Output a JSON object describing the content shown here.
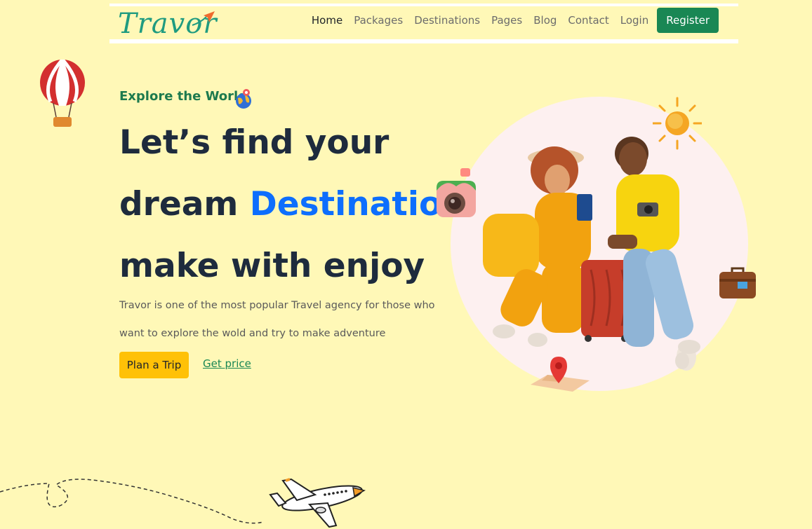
{
  "brand": {
    "name": "Travor"
  },
  "nav": {
    "links": [
      "Home",
      "Packages",
      "Destinations",
      "Pages",
      "Blog",
      "Contact",
      "Login"
    ],
    "register_label": "Register"
  },
  "hero": {
    "eyebrow": "Explore the World",
    "headline_line1": "Let’s find your",
    "headline_line2_prefix": "dream ",
    "headline_line2_accent": "Destination",
    "headline_line3": "make with enjoy",
    "description": "Travor is one of the most popular Travel agency for those who want to explore the wold and try to make adventure",
    "primary_cta": "Plan a Trip",
    "secondary_cta": "Get price"
  },
  "colors": {
    "background": "#fff8b7",
    "brand_green": "#198754",
    "accent_blue": "#0d6efd",
    "cta_yellow": "#ffc107"
  },
  "icons": [
    "hot-air-balloon-icon",
    "globe-icon",
    "paper-plane-icon",
    "sun-icon",
    "camera-icon",
    "suitcase-icon",
    "map-pin-icon",
    "airplane-icon"
  ]
}
